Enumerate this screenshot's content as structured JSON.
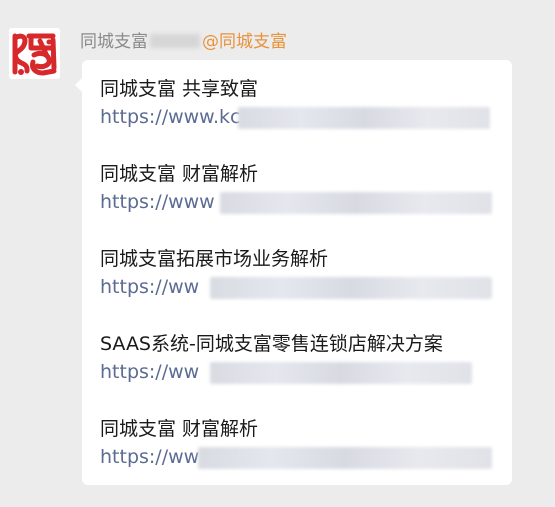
{
  "message": {
    "sender_name": "同城支富",
    "mention": "@同城支富"
  },
  "entries": [
    {
      "title": "同城支富 共享致富",
      "link": "https://www.kc"
    },
    {
      "title": "同城支富 财富解析",
      "link": "https://www"
    },
    {
      "title": "同城支富拓展市场业务解析",
      "link": "https://ww"
    },
    {
      "title": "SAAS系统-同城支富零售连锁店解决方案",
      "link": "https://ww"
    },
    {
      "title": "同城支富 财富解析",
      "link": "https://ww"
    }
  ],
  "colors": {
    "background": "#ececec",
    "bubble": "#ffffff",
    "mention": "#e8923a",
    "link": "#5b6b92",
    "seal_red": "#d7282c"
  },
  "icons": {
    "avatar": "red-seal-logo"
  }
}
